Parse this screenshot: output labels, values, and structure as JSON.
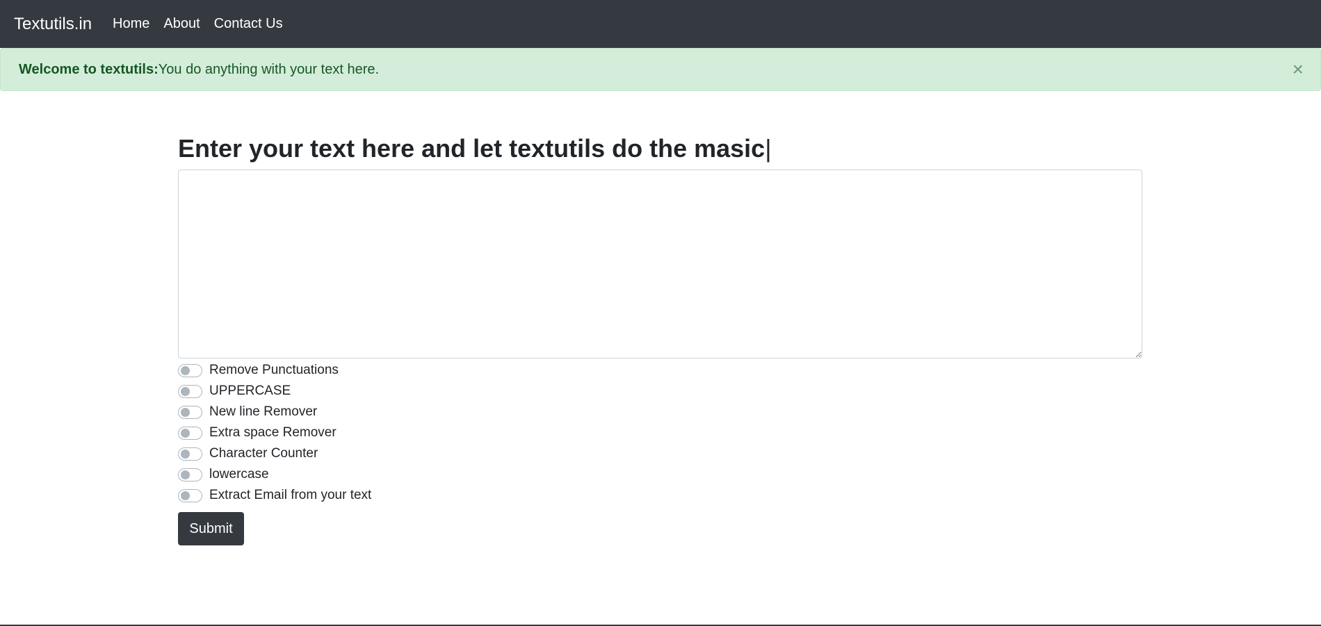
{
  "navbar": {
    "brand": "Textutils.in",
    "links": [
      "Home",
      "About",
      "Contact Us"
    ]
  },
  "alert": {
    "strong": "Welcome to textutils:",
    "message": "You do anything with your text here.",
    "close_icon": "×"
  },
  "main": {
    "heading": "Enter your text here and let textutils do the masic",
    "caret": "|",
    "textarea_value": "",
    "options": [
      "Remove Punctuations",
      "UPPERCASE",
      "New line Remover",
      "Extra space Remover",
      "Character Counter",
      "lowercase",
      "Extract Email from your text"
    ],
    "submit_label": "Submit"
  },
  "colors": {
    "navbar_bg": "#343a40",
    "alert_bg": "#d4edda",
    "alert_text": "#155724",
    "button_bg": "#343a40"
  }
}
